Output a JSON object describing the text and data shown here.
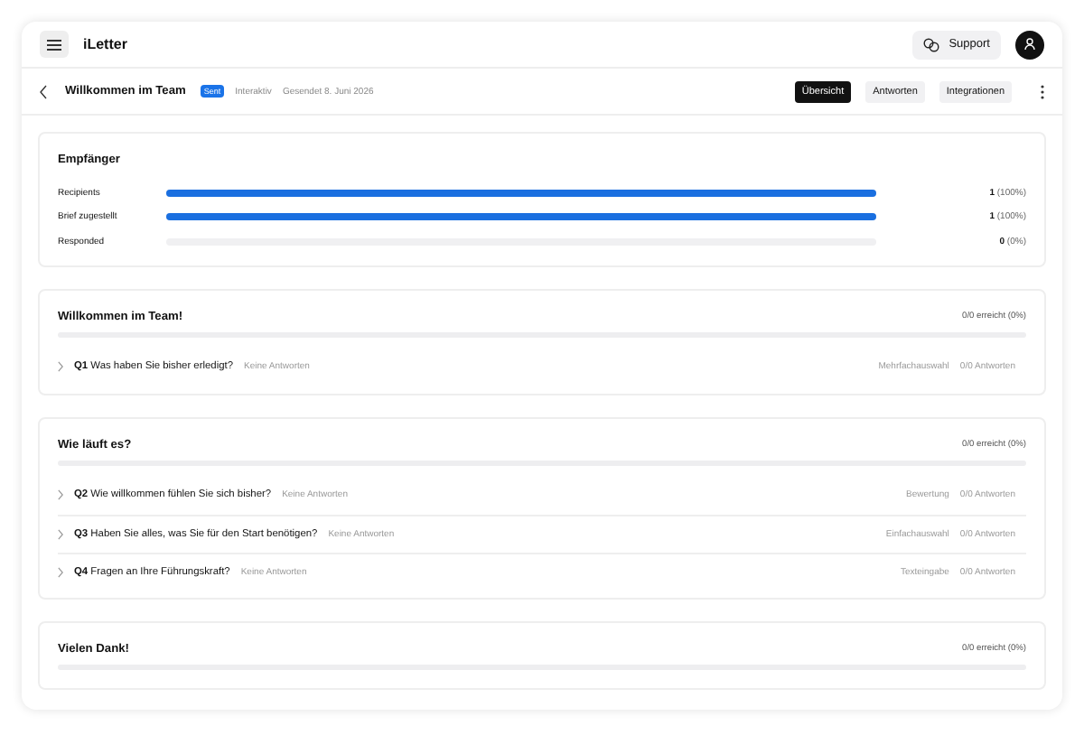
{
  "app": {
    "title": "iLetter",
    "support": "Support"
  },
  "header": {
    "title": "Willkommen im Team",
    "badge": "Sent",
    "type": "Interaktiv",
    "sent": "Gesendet 8. Juni 2026",
    "tabs": [
      {
        "label": "Übersicht",
        "selected": true
      },
      {
        "label": "Antworten",
        "selected": false
      },
      {
        "label": "Integrationen",
        "selected": false
      }
    ]
  },
  "recipients": {
    "title": "Empfänger",
    "metrics": [
      {
        "label": "Recipients",
        "level": 1,
        "count": "**1** (100%)"
      },
      {
        "label": "Brief zugestellt",
        "level": 1,
        "count": "**1** (100%)"
      },
      {
        "label": "Responded",
        "level": 0,
        "count": "**0** (0%)"
      }
    ]
  },
  "sections": [
    {
      "title": "Willkommen im Team!",
      "progress": "0/0 erreicht (0%)",
      "level": 0,
      "questions": [
        {
          "text": "**Q1** Was haben Sie bisher erledigt?",
          "status": "Keine Antworten",
          "type": "Mehrfachauswahl",
          "answers": "0/0 Antworten"
        }
      ]
    },
    {
      "title": "Wie läuft es?",
      "progress": "0/0 erreicht (0%)",
      "level": 0,
      "questions": [
        {
          "text": "**Q2** Wie willkommen fühlen Sie sich bisher?",
          "status": "Keine Antworten",
          "type": "Bewertung",
          "answers": "0/0 Antworten"
        },
        {
          "text": "**Q3** Haben Sie alles, was Sie für den Start benötigen?",
          "status": "Keine Antworten",
          "type": "Einfachauswahl",
          "answers": "0/0 Antworten"
        },
        {
          "text": "**Q4** Fragen an Ihre Führungskraft?",
          "status": "Keine Antworten",
          "type": "Texteingabe",
          "answers": "0/0 Antworten"
        }
      ]
    },
    {
      "title": "Vielen Dank!",
      "progress": "0/0 erreicht (0%)",
      "level": 0
    }
  ]
}
